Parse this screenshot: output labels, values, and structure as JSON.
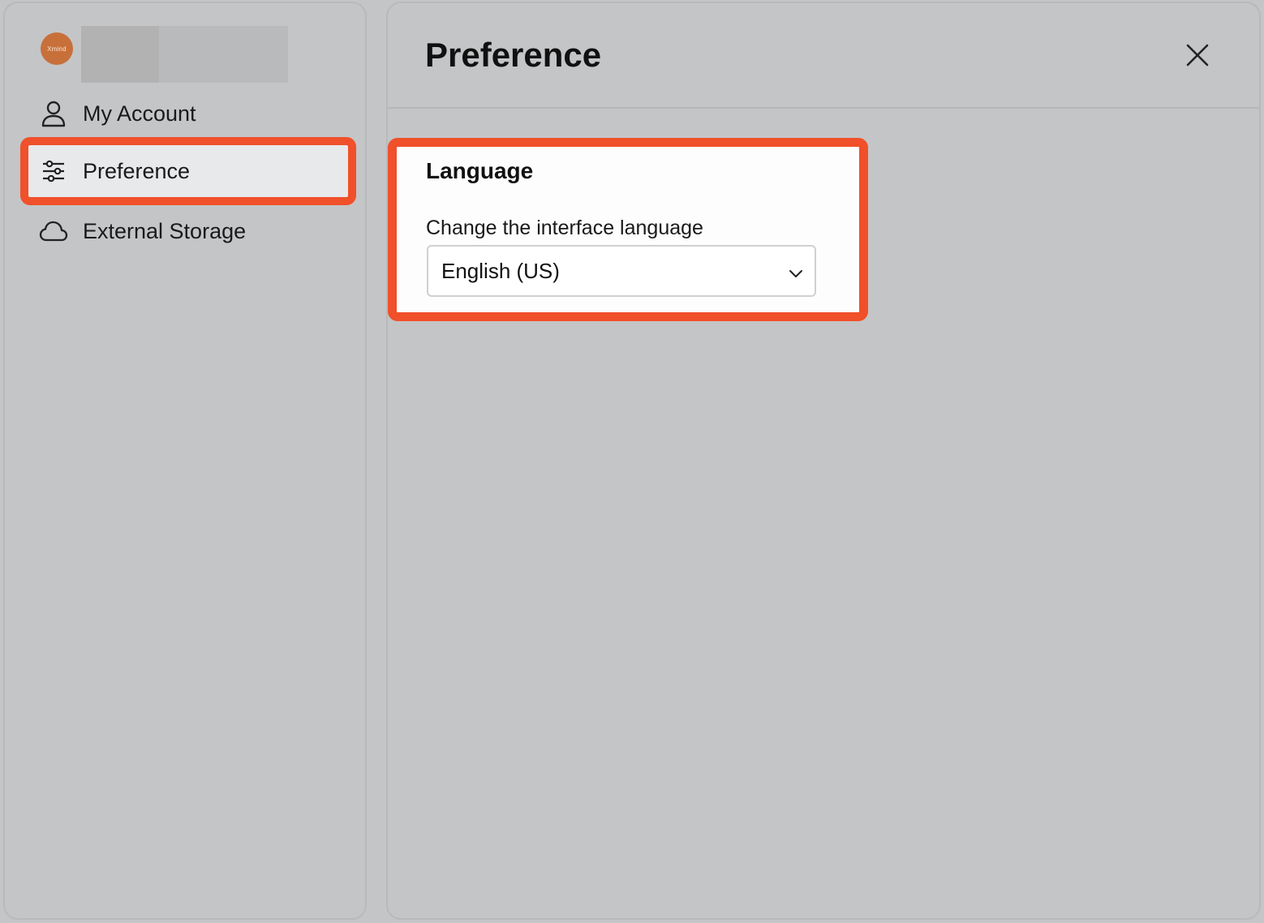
{
  "sidebar": {
    "avatar": {
      "text": "Xmind",
      "color": "#c8703a"
    },
    "items": [
      {
        "label": "My Account",
        "icon": "person-icon",
        "selected": false
      },
      {
        "label": "Preference",
        "icon": "sliders-icon",
        "selected": true
      },
      {
        "label": "External Storage",
        "icon": "cloud-icon",
        "selected": false
      }
    ]
  },
  "main": {
    "title": "Preference",
    "close_icon": "close-icon",
    "language": {
      "title": "Language",
      "description": "Change the interface language",
      "selected_value": "English (US)"
    }
  },
  "colors": {
    "highlight": "#f0502a",
    "background": "#c4c5c7"
  }
}
